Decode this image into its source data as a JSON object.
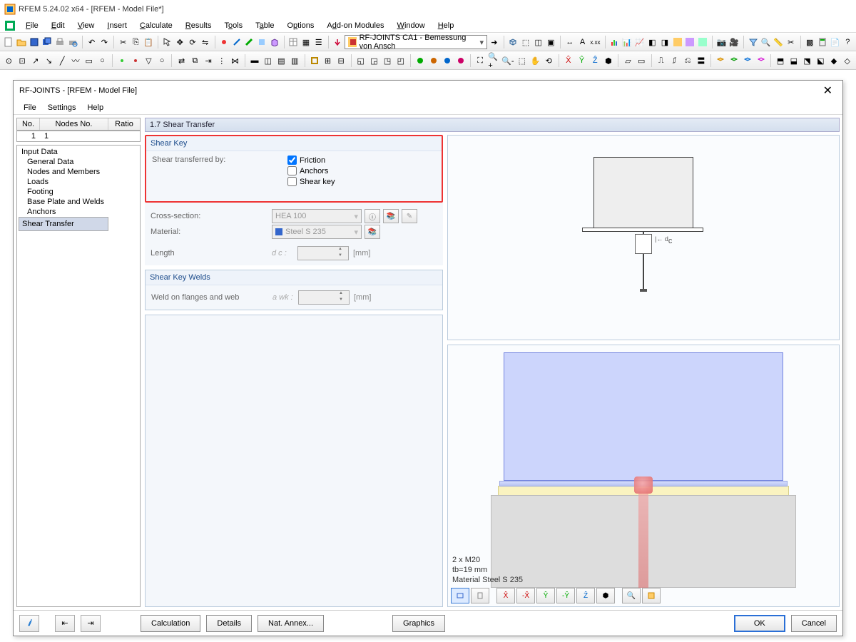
{
  "app": {
    "title": "RFEM 5.24.02 x64 - [RFEM - Model File*]",
    "menus": [
      "File",
      "Edit",
      "View",
      "Insert",
      "Calculate",
      "Results",
      "Tools",
      "Table",
      "Options",
      "Add-on Modules",
      "Window",
      "Help"
    ],
    "module_combo": "RF-JOINTS CA1 - Bemessung von Ansch"
  },
  "dialog": {
    "title": "RF-JOINTS - [RFEM - Model File]",
    "menus": [
      "File",
      "Settings",
      "Help"
    ],
    "table": {
      "headers": [
        "No.",
        "Nodes No.",
        "Ratio"
      ],
      "rows": [
        {
          "no": "1",
          "nodes": "1",
          "ratio": ""
        }
      ]
    },
    "tree": {
      "root": "Input Data",
      "items": [
        "General Data",
        "Nodes and Members",
        "Loads",
        "Footing",
        "Base Plate and Welds",
        "Anchors",
        "Shear Transfer"
      ],
      "selected": "Shear Transfer"
    },
    "panel_title": "1.7 Shear Transfer",
    "shear_key": {
      "group": "Shear Key",
      "label": "Shear transferred by:",
      "opts": {
        "friction": "Friction",
        "anchors": "Anchors",
        "shearkey": "Shear key"
      },
      "friction_checked": true,
      "cross_section_lbl": "Cross-section:",
      "cross_section_val": "HEA 100",
      "material_lbl": "Material:",
      "material_val": "Steel S 235",
      "length_lbl": "Length",
      "length_sym": "d c :",
      "unit": "[mm]"
    },
    "welds": {
      "group": "Shear Key Welds",
      "label": "Weld on flanges and web",
      "sym": "a wk :",
      "unit": "[mm]"
    },
    "render": {
      "line1": "2 x M20",
      "line2": "tb=19 mm",
      "line3": "Material Steel S 235"
    },
    "buttons": {
      "calc": "Calculation",
      "details": "Details",
      "annex": "Nat. Annex...",
      "graphics": "Graphics",
      "ok": "OK",
      "cancel": "Cancel"
    }
  }
}
